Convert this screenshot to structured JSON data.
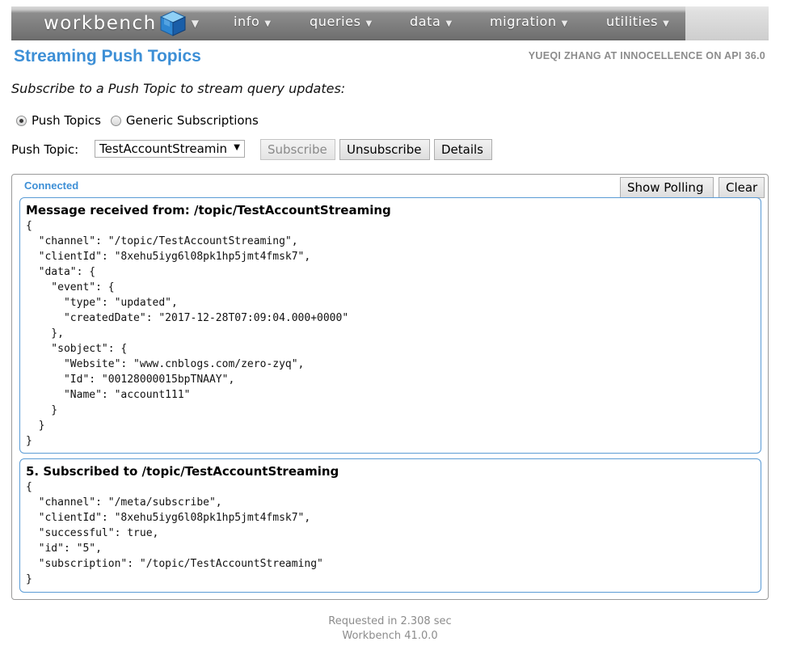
{
  "nav": {
    "brand": "workbench",
    "menus": [
      "info",
      "queries",
      "data",
      "migration",
      "utilities"
    ]
  },
  "header": {
    "title": "Streaming Push Topics",
    "user": "YUEQI ZHANG AT INNOCELLENCE ON API 36.0"
  },
  "intro": "Subscribe to a Push Topic to stream query updates:",
  "radios": [
    {
      "label": "Push Topics",
      "checked": true
    },
    {
      "label": "Generic Subscriptions",
      "checked": false
    }
  ],
  "topic_row": {
    "label": "Push Topic:",
    "selected": "TestAccountStreamin",
    "buttons": {
      "subscribe": "Subscribe",
      "unsubscribe": "Unsubscribe",
      "details": "Details"
    }
  },
  "stream": {
    "status": "Connected",
    "buttons": {
      "show_polling": "Show Polling",
      "clear": "Clear"
    },
    "messages": [
      {
        "title": "Message received from: /topic/TestAccountStreaming",
        "body": "{\n  \"channel\": \"/topic/TestAccountStreaming\",\n  \"clientId\": \"8xehu5iyg6l08pk1hp5jmt4fmsk7\",\n  \"data\": {\n    \"event\": {\n      \"type\": \"updated\",\n      \"createdDate\": \"2017-12-28T07:09:04.000+0000\"\n    },\n    \"sobject\": {\n      \"Website\": \"www.cnblogs.com/zero-zyq\",\n      \"Id\": \"00128000015bpTNAAY\",\n      \"Name\": \"account111\"\n    }\n  }\n}"
      },
      {
        "title": "5. Subscribed to /topic/TestAccountStreaming",
        "body": "{\n  \"channel\": \"/meta/subscribe\",\n  \"clientId\": \"8xehu5iyg6l08pk1hp5jmt4fmsk7\",\n  \"successful\": true,\n  \"id\": \"5\",\n  \"subscription\": \"/topic/TestAccountStreaming\"\n}"
      }
    ]
  },
  "footer": {
    "timing": "Requested in 2.308 sec",
    "version": "Workbench 41.0.0"
  },
  "colors": {
    "accent": "#3d8fd6",
    "message_border": "#5a9bd5",
    "muted": "#8c8c8c"
  }
}
